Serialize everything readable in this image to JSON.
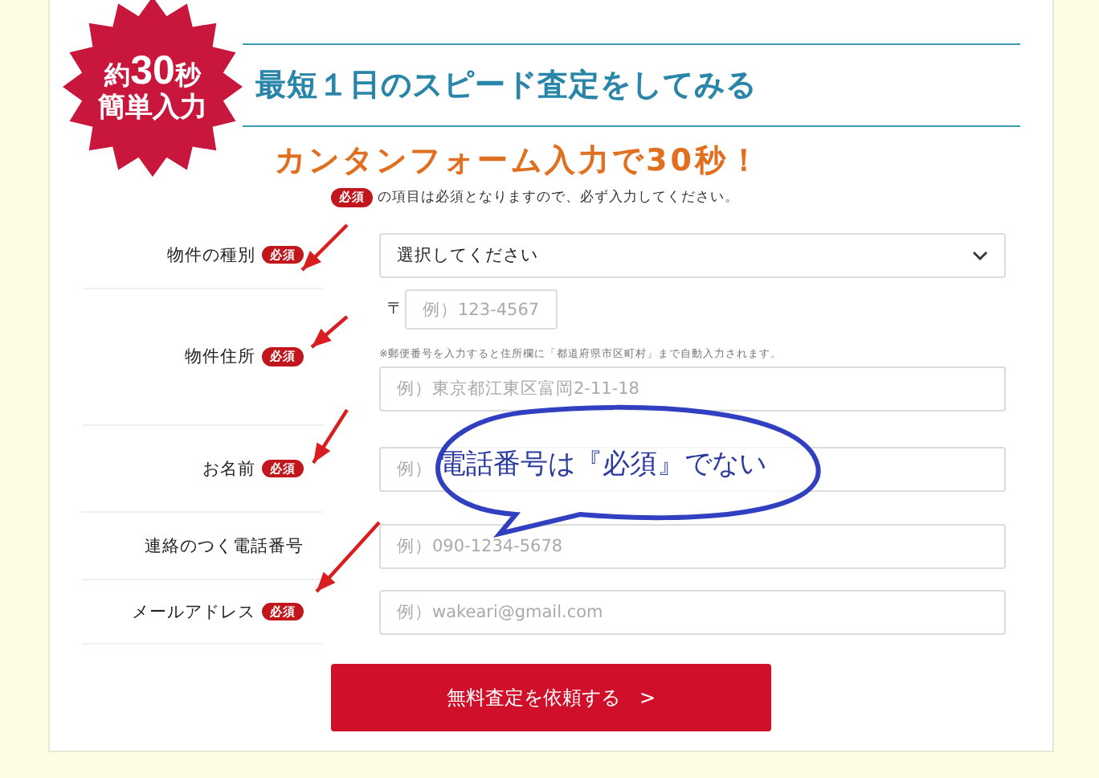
{
  "badge": {
    "prefix": "約",
    "number": "30",
    "suffix": "秒",
    "line2": "簡単入力"
  },
  "title": "最短１日のスピード査定をしてみる",
  "subtitle": "カンタンフォーム入力で30秒！",
  "note": {
    "badge": "必須",
    "text": "の項目は必須となりますので、必ず入力してください。"
  },
  "rows": [
    {
      "label": "物件の種別",
      "required_badge": "必須",
      "kind": "select",
      "value": "選択してください"
    },
    {
      "label": "物件住所",
      "required_badge": "必須",
      "kind": "address",
      "postal_mark": "〒",
      "postal_placeholder": "例）123-4567",
      "hint": "※郵便番号を入力すると住所欄に「都道府県市区町村」まで自動入力されます。",
      "placeholder": "例）東京都江東区富岡2-11-18"
    },
    {
      "label": "お名前",
      "required_badge": "必須",
      "kind": "text",
      "placeholder": "例）"
    },
    {
      "label": "連絡のつく電話番号",
      "kind": "text",
      "placeholder": "例）090-1234-5678"
    },
    {
      "label": "メールアドレス",
      "required_badge": "必須",
      "kind": "text",
      "placeholder": "例）wakeari@gmail.com"
    }
  ],
  "submit": "無料査定を依頼する　>",
  "annotation": "電話番号は『必須』でない"
}
